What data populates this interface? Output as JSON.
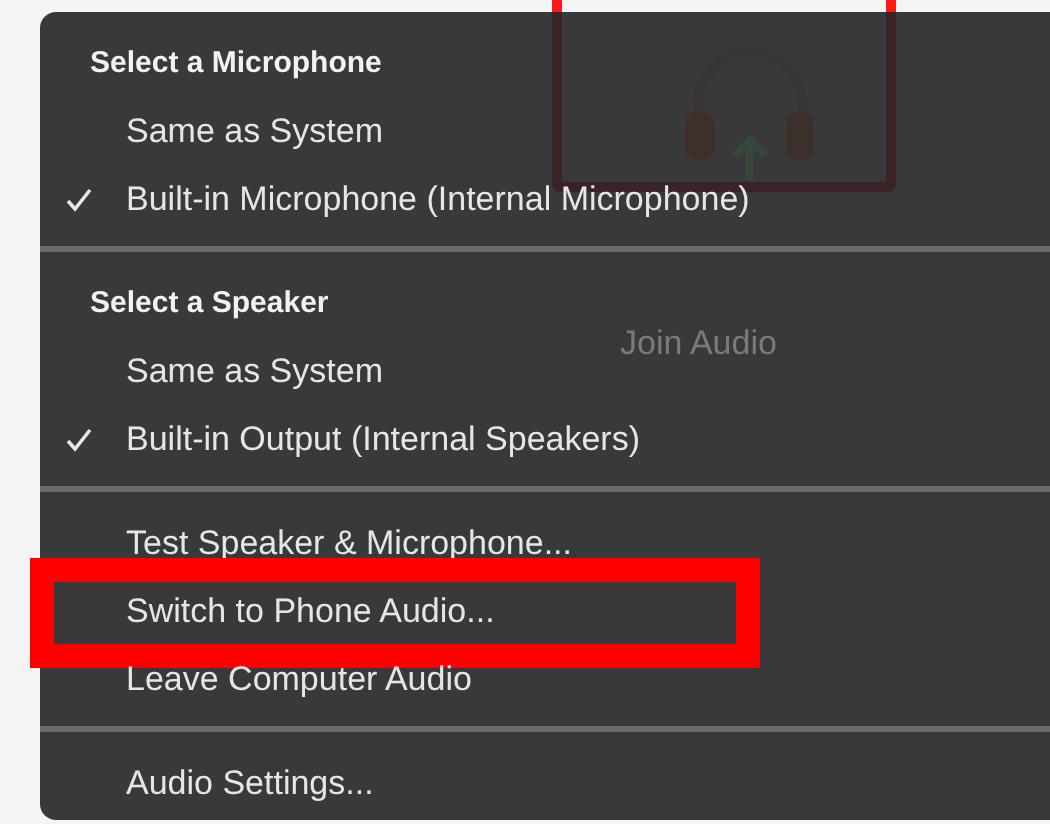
{
  "background": {
    "title": "Join Audio"
  },
  "menu": {
    "sections": [
      {
        "kind": "choice",
        "header": "Select a Microphone",
        "items": [
          {
            "label": "Same as System",
            "checked": false
          },
          {
            "label": "Built-in Microphone (Internal Microphone)",
            "checked": true
          }
        ]
      },
      {
        "kind": "choice",
        "header": "Select a Speaker",
        "items": [
          {
            "label": "Same as System",
            "checked": false
          },
          {
            "label": "Built-in Output (Internal Speakers)",
            "checked": true
          }
        ]
      },
      {
        "kind": "actions",
        "items": [
          {
            "label": "Test Speaker & Microphone...",
            "highlighted": false
          },
          {
            "label": "Switch to Phone Audio...",
            "highlighted": true
          },
          {
            "label": "Leave Computer Audio",
            "highlighted": false
          }
        ]
      },
      {
        "kind": "actions",
        "items": [
          {
            "label": "Audio Settings...",
            "highlighted": false
          }
        ]
      }
    ]
  }
}
